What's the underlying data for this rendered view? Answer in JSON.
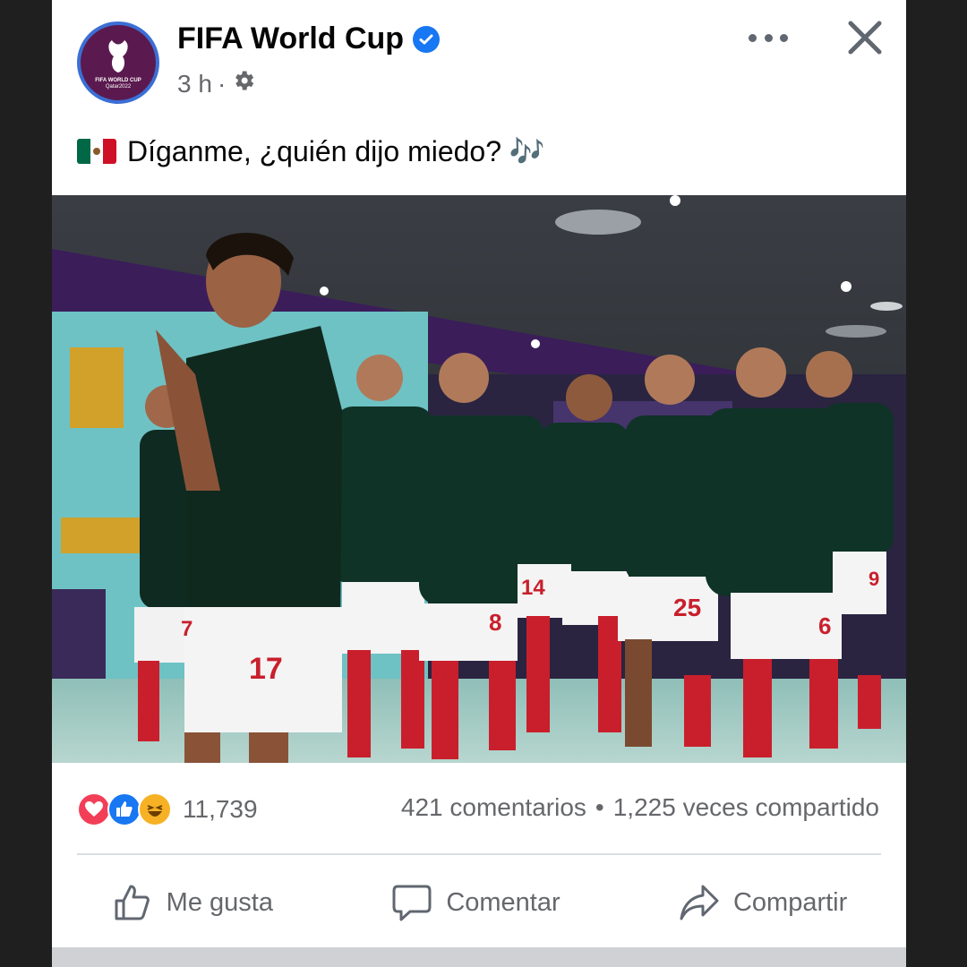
{
  "post": {
    "page_name": "FIFA World Cup",
    "verified": true,
    "time": "3 h",
    "privacy_icon": "gear-icon",
    "avatar_text_line1": "FIFA WORLD CUP",
    "avatar_text_line2": "Qatar2022",
    "caption": "Díganme, ¿quién dijo miedo? 🎶",
    "caption_flag": "mexico-flag"
  },
  "photo": {
    "jersey_numbers": [
      "17",
      "7",
      "8",
      "14",
      "25",
      "6",
      "9"
    ]
  },
  "engagement": {
    "reaction_icons": [
      "love-icon",
      "like-icon",
      "haha-icon"
    ],
    "reactions_count": "11,739",
    "comments": "421 comentarios",
    "dot": "•",
    "shares": "1,225 veces compartido"
  },
  "actions": {
    "like": "Me gusta",
    "comment": "Comentar",
    "share": "Compartir"
  },
  "colors": {
    "brand_blue": "#1877f2",
    "text_primary": "#050505",
    "text_secondary": "#65676b",
    "avatar_bg": "#5b1a4f"
  }
}
